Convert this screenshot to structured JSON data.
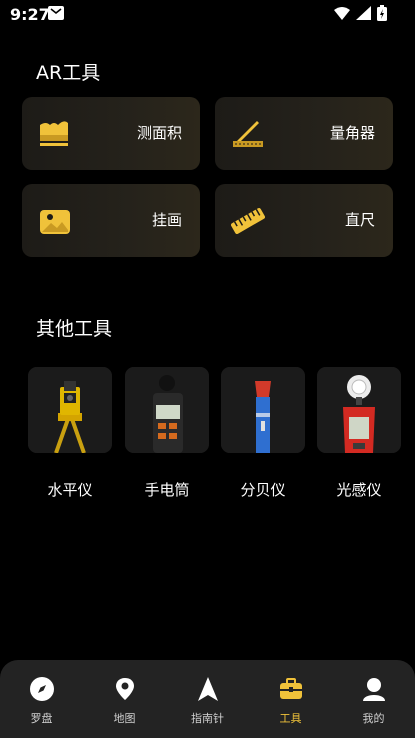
{
  "status_bar": {
    "time": "9:27"
  },
  "ar_section": {
    "title": "AR工具",
    "cards": [
      {
        "label": "测面积",
        "icon": "area-chart-icon"
      },
      {
        "label": "量角器",
        "icon": "protractor-icon"
      },
      {
        "label": "挂画",
        "icon": "picture-icon"
      },
      {
        "label": "直尺",
        "icon": "ruler-icon"
      }
    ]
  },
  "other_section": {
    "title": "其他工具",
    "tools": [
      {
        "label": "水平仪",
        "icon": "total-station-image"
      },
      {
        "label": "手电筒",
        "icon": "sound-meter-image"
      },
      {
        "label": "分贝仪",
        "icon": "flashlight-image"
      },
      {
        "label": "光感仪",
        "icon": "light-meter-image"
      }
    ]
  },
  "bottom_nav": {
    "items": [
      {
        "label": "罗盘",
        "icon": "compass-icon"
      },
      {
        "label": "地图",
        "icon": "map-pin-icon"
      },
      {
        "label": "指南针",
        "icon": "navigation-arrow-icon"
      },
      {
        "label": "工具",
        "icon": "toolbox-icon",
        "active": true
      },
      {
        "label": "我的",
        "icon": "user-icon"
      }
    ]
  },
  "colors": {
    "accent": "#f0c23a",
    "card_bg": "#1f1d18",
    "nav_bg": "#232323"
  }
}
